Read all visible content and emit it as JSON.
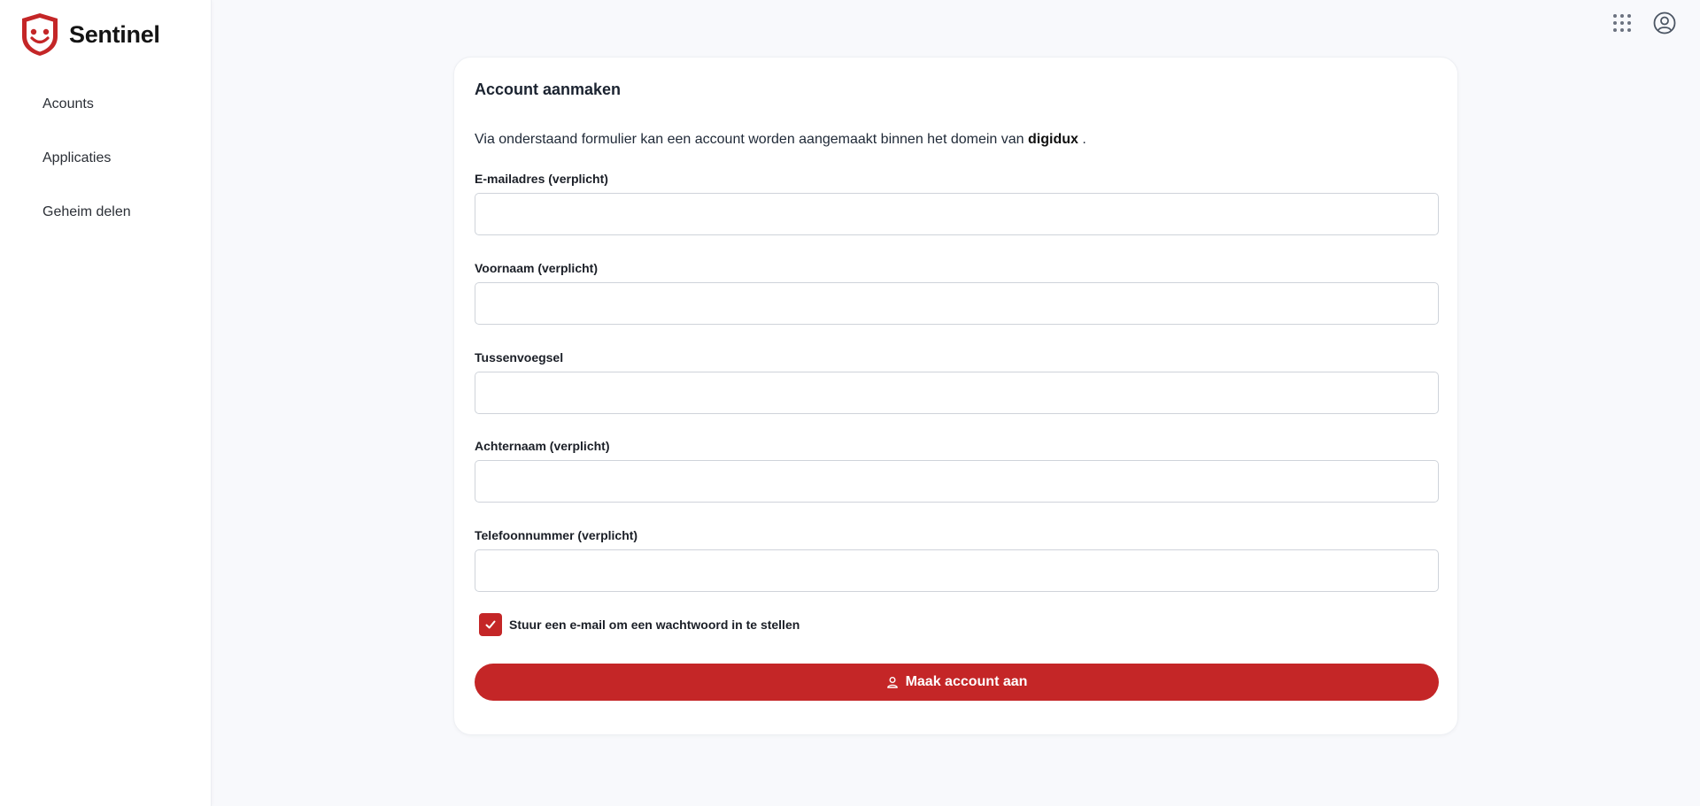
{
  "brand": {
    "name": "Sentinel",
    "accent": "#c42627"
  },
  "sidebar": {
    "items": [
      {
        "label": "Acounts"
      },
      {
        "label": "Applicaties"
      },
      {
        "label": "Geheim delen"
      }
    ]
  },
  "topbar": {
    "icons": [
      "apps-grid-icon",
      "user-circle-icon"
    ]
  },
  "form": {
    "title": "Account aanmaken",
    "intro_text": "Via onderstaand formulier kan een account worden aangemaakt binnen het domein van ",
    "domain": "digidux",
    "intro_suffix": " .",
    "fields": [
      {
        "label": "E-mailadres (verplicht)",
        "value": "",
        "placeholder": ""
      },
      {
        "label": "Voornaam (verplicht)",
        "value": "",
        "placeholder": ""
      },
      {
        "label": "Tussenvoegsel",
        "value": "",
        "placeholder": ""
      },
      {
        "label": "Achternaam (verplicht)",
        "value": "",
        "placeholder": ""
      },
      {
        "label": "Telefoonnummer (verplicht)",
        "value": "",
        "placeholder": ""
      }
    ],
    "send_reset_email": {
      "label": "Stuur een e-mail om een wachtwoord in te stellen",
      "checked": true
    },
    "submit_label": "Maak account aan"
  }
}
